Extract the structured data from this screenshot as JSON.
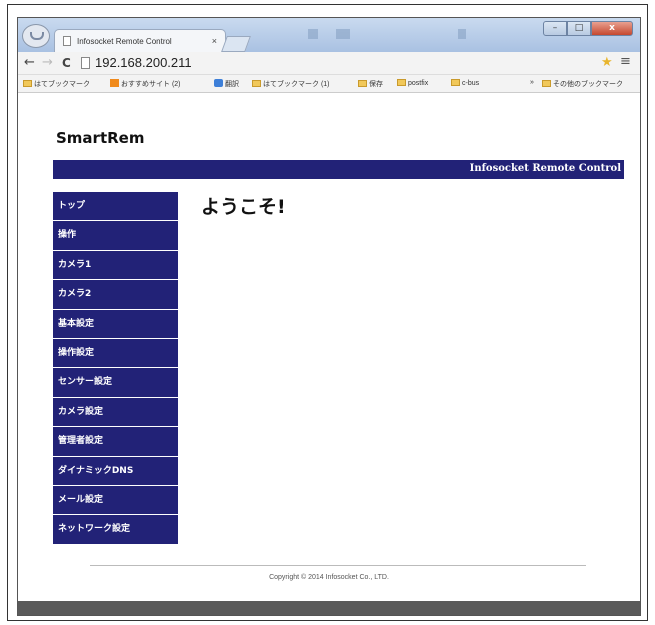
{
  "browser": {
    "tab_title": "Infosocket Remote Control",
    "tab_close": "×",
    "url": "192.168.200.211",
    "window_controls": {
      "minimize": "–",
      "maximize": "□",
      "close": "x"
    },
    "nav": {
      "back": "←",
      "forward": "→",
      "reload": "C"
    },
    "star_icon": "★",
    "menu_icon": "≡"
  },
  "bookmarks": {
    "items": [
      {
        "label": "はてブックマーク"
      },
      {
        "label": "おすすめサイト (2)"
      },
      {
        "label": "翻訳"
      },
      {
        "label": "はてブックマーク (1)"
      },
      {
        "label": "保存"
      },
      {
        "label": "postfix"
      },
      {
        "label": "c-bus"
      }
    ],
    "overflow": "»",
    "other": "その他のブックマーク"
  },
  "site": {
    "title": "SmartRem",
    "banner": "Infosocket Remote Control",
    "heading": "ようこそ!",
    "copyright": "Copyright © 2014 Infosocket Co., LTD."
  },
  "sidebar": {
    "items": [
      {
        "label": "トップ"
      },
      {
        "label": "操作"
      },
      {
        "label": "カメラ1"
      },
      {
        "label": "カメラ2"
      },
      {
        "label": "基本設定"
      },
      {
        "label": "操作設定"
      },
      {
        "label": "センサー設定"
      },
      {
        "label": "カメラ設定"
      },
      {
        "label": "管理者設定"
      },
      {
        "label": "ダイナミックDNS"
      },
      {
        "label": "メール設定"
      },
      {
        "label": "ネットワーク設定"
      }
    ]
  },
  "colors": {
    "brand_navy": "#222277",
    "chrome_blue": "#a9c1e2"
  }
}
